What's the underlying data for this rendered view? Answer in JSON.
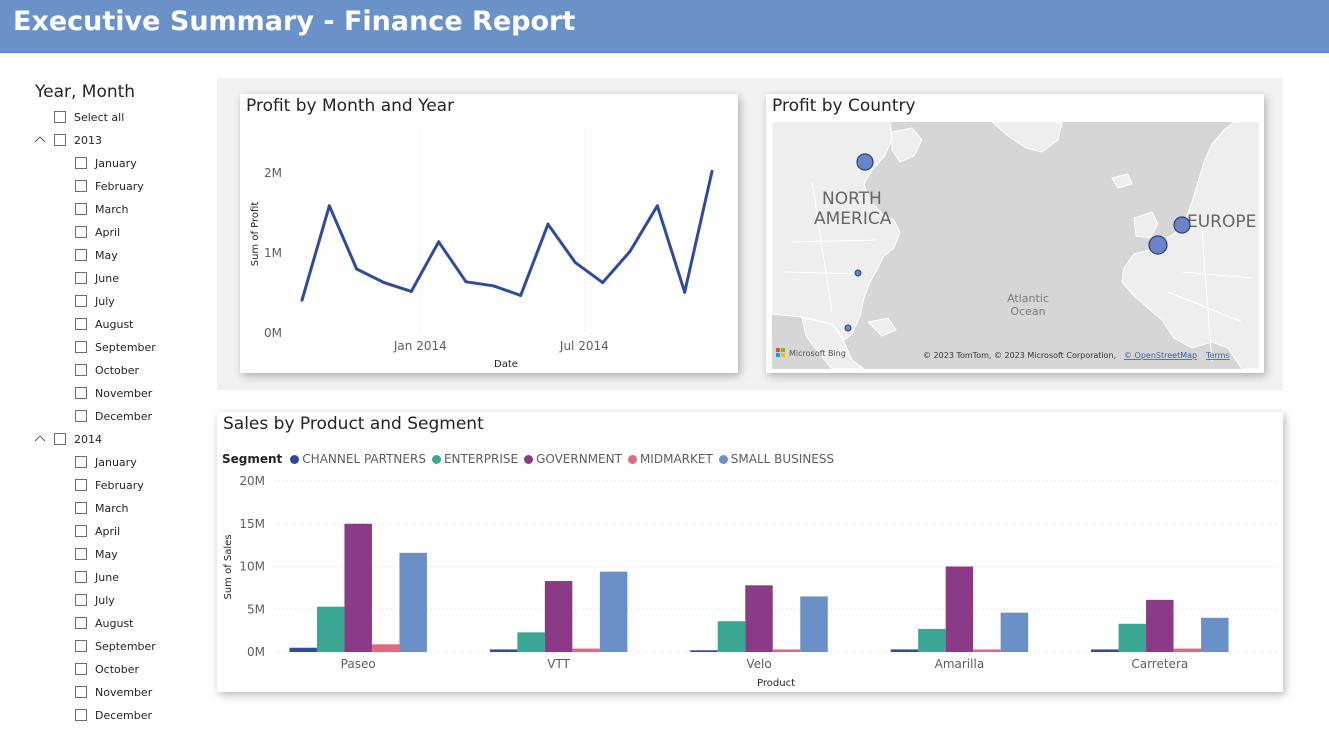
{
  "header": {
    "title": "Executive Summary - Finance Report"
  },
  "slicer": {
    "title": "Year, Month",
    "select_all": "Select all",
    "years": [
      {
        "label": "2013",
        "months": [
          "January",
          "February",
          "March",
          "April",
          "May",
          "June",
          "July",
          "August",
          "September",
          "October",
          "November",
          "December"
        ]
      },
      {
        "label": "2014",
        "months": [
          "January",
          "February",
          "March",
          "April",
          "May",
          "June",
          "July",
          "August",
          "September",
          "October",
          "November",
          "December"
        ]
      }
    ]
  },
  "profit_month": {
    "title": "Profit by Month and Year",
    "ylabel": "Sum of Profit",
    "xlabel": "Date",
    "y_ticks": [
      "2M",
      "1M",
      "0M"
    ],
    "x_ticks": [
      "Jan 2014",
      "Jul 2014"
    ],
    "line_color": "#2f4b9c"
  },
  "profit_country": {
    "title": "Profit by Country",
    "labels": {
      "north_america": [
        "NORTH",
        "AMERICA"
      ],
      "europe": "EUROPE",
      "ocean": [
        "Atlantic",
        "Ocean"
      ]
    },
    "bing": "Microsoft Bing",
    "attribution": "© 2023 TomTom, © 2023 Microsoft Corporation,",
    "osm_link": "© OpenStreetMap",
    "terms": "Terms",
    "bubble_color": "#6b84c9"
  },
  "sales": {
    "title": "Sales by Product and Segment",
    "legend_title": "Segment",
    "ylabel": "Sum of Sales",
    "xlabel": "Product",
    "y_ticks": [
      "20M",
      "15M",
      "10M",
      "5M",
      "0M"
    ]
  },
  "chart_data": [
    {
      "type": "line",
      "title": "Profit by Month and Year",
      "xlabel": "Date",
      "ylabel": "Sum of Profit",
      "x": [
        "Sep 2013",
        "Oct 2013",
        "Nov 2013",
        "Dec 2013",
        "Jan 2014",
        "Feb 2014",
        "Mar 2014",
        "Apr 2014",
        "May 2014",
        "Jun 2014",
        "Jul 2014",
        "Aug 2014",
        "Sep 2014",
        "Oct 2014",
        "Nov 2014",
        "Dec 2014"
      ],
      "values": [
        0.41,
        1.59,
        0.8,
        0.63,
        0.52,
        1.14,
        0.64,
        0.59,
        0.47,
        1.36,
        0.88,
        0.63,
        1.02,
        1.59,
        0.51,
        2.02
      ],
      "unit": "M",
      "ylim": [
        0,
        2.5
      ],
      "x_ticks": [
        "Jan 2014",
        "Jul 2014"
      ],
      "y_ticks": [
        "0M",
        "1M",
        "2M"
      ]
    },
    {
      "type": "bar",
      "title": "Sales by Product and Segment",
      "xlabel": "Product",
      "ylabel": "Sum of Sales",
      "categories": [
        "Paseo",
        "VTT",
        "Velo",
        "Amarilla",
        "Carretera"
      ],
      "series": [
        {
          "name": "CHANNEL PARTNERS",
          "color": "#2f4b9c",
          "values": [
            0.5,
            0.3,
            0.2,
            0.3,
            0.3
          ]
        },
        {
          "name": "ENTERPRISE",
          "color": "#3aa794",
          "values": [
            5.3,
            2.3,
            3.6,
            2.7,
            3.3
          ]
        },
        {
          "name": "GOVERNMENT",
          "color": "#8b3a87",
          "values": [
            15.0,
            8.3,
            7.8,
            10.0,
            6.1
          ]
        },
        {
          "name": "MIDMARKET",
          "color": "#e0697f",
          "values": [
            0.9,
            0.4,
            0.3,
            0.3,
            0.4
          ]
        },
        {
          "name": "SMALL BUSINESS",
          "color": "#6a90c8",
          "values": [
            11.6,
            9.4,
            6.5,
            4.6,
            4.0
          ]
        }
      ],
      "ylim": [
        0,
        20
      ],
      "unit": "M",
      "y_ticks": [
        "0M",
        "5M",
        "10M",
        "15M",
        "20M"
      ],
      "legend": "top-left"
    }
  ]
}
